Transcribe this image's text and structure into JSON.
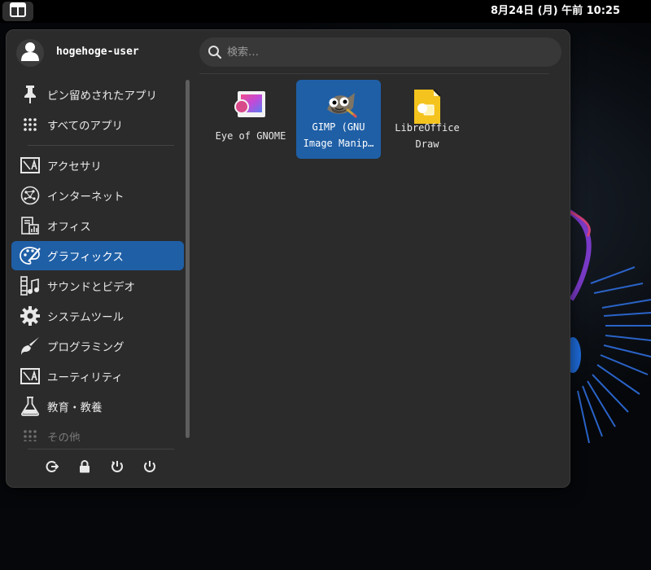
{
  "topbar": {
    "activities_icon": "activities-grid-icon",
    "clock": "8月24日 (月) 午前 10:25"
  },
  "menu": {
    "user": {
      "avatar_icon": "user-avatar-icon",
      "name": "hogehoge-user"
    },
    "search": {
      "icon": "search-icon",
      "placeholder": "検索…",
      "value": ""
    },
    "sidebar": {
      "items": [
        {
          "label": "ピン留めされたアプリ",
          "icon": "pin-icon"
        },
        {
          "label": "すべてのアプリ",
          "icon": "grid-dots-icon"
        },
        {
          "label": "アクセサリ",
          "icon": "accessories-icon"
        },
        {
          "label": "インターネット",
          "icon": "internet-icon"
        },
        {
          "label": "オフィス",
          "icon": "office-icon"
        },
        {
          "label": "グラフィックス",
          "icon": "graphics-palette-icon",
          "selected": true
        },
        {
          "label": "サウンドとビデオ",
          "icon": "sound-video-icon"
        },
        {
          "label": "システムツール",
          "icon": "gear-icon"
        },
        {
          "label": "プログラミング",
          "icon": "brush-icon"
        },
        {
          "label": "ユーティリティ",
          "icon": "utilities-icon"
        },
        {
          "label": "教育・教養",
          "icon": "flask-icon"
        },
        {
          "label": "その他",
          "icon": "grid-dots-icon"
        }
      ]
    },
    "actions": [
      {
        "name": "logout",
        "icon": "logout-icon"
      },
      {
        "name": "lock",
        "icon": "lock-icon"
      },
      {
        "name": "restart",
        "icon": "restart-icon"
      },
      {
        "name": "power",
        "icon": "power-icon"
      }
    ],
    "apps": [
      {
        "label": "Eye of GNOME",
        "icon": "eye-of-gnome-icon",
        "selected": false
      },
      {
        "label": "GIMP (GNU\nImage Manip…",
        "icon": "gimp-icon",
        "selected": true
      },
      {
        "label": "LibreOffice\nDraw",
        "icon": "libreoffice-draw-icon",
        "selected": false
      }
    ]
  },
  "colors": {
    "panel": "#2b2b2b",
    "accent": "#1f5fa6",
    "search_bg": "#383838",
    "topbar": "#000000"
  }
}
